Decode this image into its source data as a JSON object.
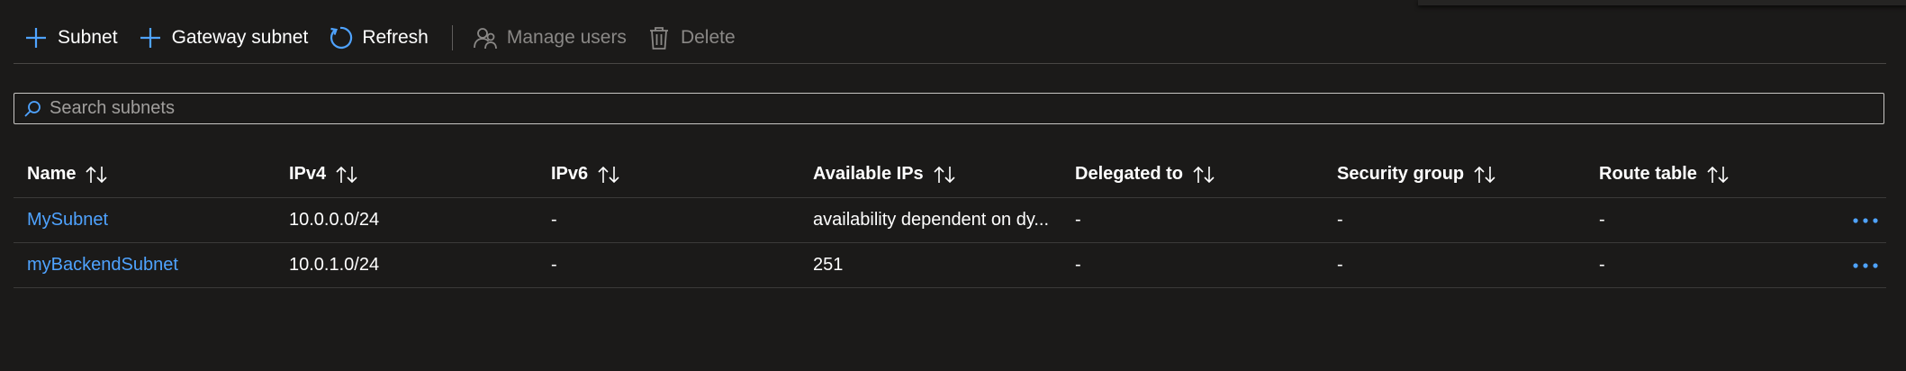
{
  "toolbar": {
    "add_subnet_label": "Subnet",
    "gateway_subnet_label": "Gateway subnet",
    "refresh_label": "Refresh",
    "manage_users_label": "Manage users",
    "delete_label": "Delete"
  },
  "search": {
    "placeholder": "Search subnets",
    "value": ""
  },
  "table": {
    "columns": [
      "Name",
      "IPv4",
      "IPv6",
      "Available IPs",
      "Delegated to",
      "Security group",
      "Route table"
    ],
    "rows": [
      {
        "name": "MySubnet",
        "ipv4": "10.0.0.0/24",
        "ipv6": "-",
        "available_ips": "availability dependent on dy...",
        "delegated_to": "-",
        "security_group": "-",
        "route_table": "-"
      },
      {
        "name": "myBackendSubnet",
        "ipv4": "10.0.1.0/24",
        "ipv6": "-",
        "available_ips": "251",
        "delegated_to": "-",
        "security_group": "-",
        "route_table": "-"
      }
    ]
  },
  "icons": {
    "add": "plus-icon",
    "refresh": "refresh-icon",
    "manage_users": "people-icon",
    "delete": "trash-icon",
    "search": "search-icon",
    "sort": "sort-icon",
    "more": "more-icon"
  },
  "colors": {
    "background": "#1b1a19",
    "accent": "#4fa3ff",
    "disabled": "#8a8886",
    "border": "#3b3a39"
  }
}
